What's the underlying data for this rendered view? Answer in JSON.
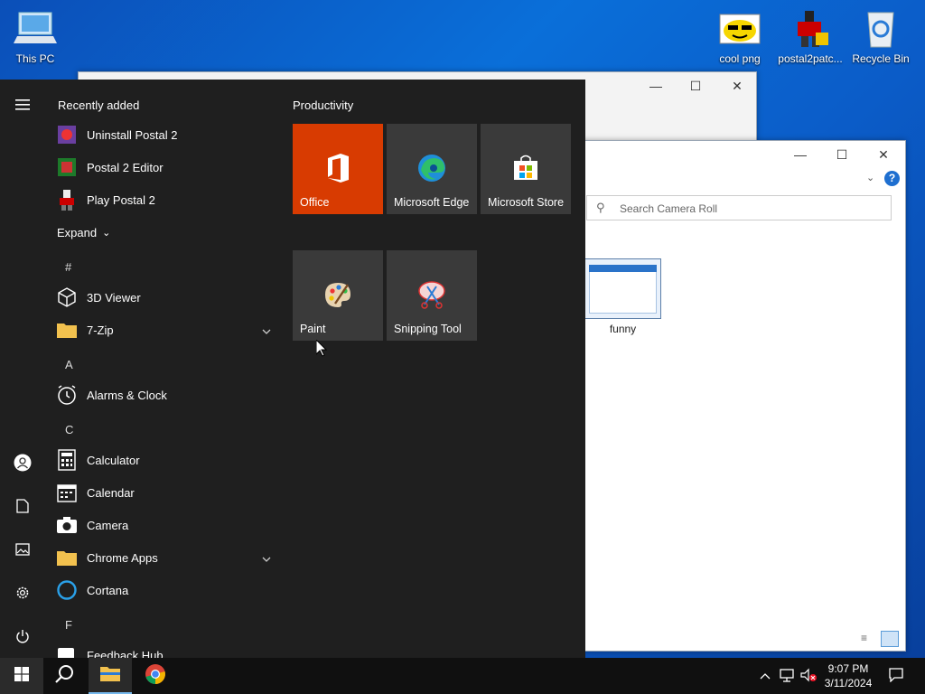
{
  "desktop": {
    "icons": [
      {
        "label": "This PC"
      },
      {
        "label": "cool png"
      },
      {
        "label": "postal2patc..."
      },
      {
        "label": "Recycle Bin"
      }
    ]
  },
  "explorer": {
    "search_placeholder": "Search Camera Roll",
    "file_label": "funny"
  },
  "start_menu": {
    "recently_added_label": "Recently added",
    "recent_items": [
      "Uninstall Postal 2",
      "Postal 2 Editor",
      "Play Postal 2"
    ],
    "expand_label": "Expand",
    "sections": {
      "hash": "#",
      "a": "A",
      "c": "C",
      "f": "F"
    },
    "apps": {
      "viewer3d": "3D Viewer",
      "zip": "7-Zip",
      "alarms": "Alarms & Clock",
      "calculator": "Calculator",
      "calendar": "Calendar",
      "camera": "Camera",
      "chrome_apps": "Chrome Apps",
      "cortana": "Cortana",
      "feedback": "Feedback Hub"
    },
    "group_title": "Productivity",
    "tiles": {
      "office": "Office",
      "edge": "Microsoft Edge",
      "store": "Microsoft Store",
      "paint": "Paint",
      "snipping": "Snipping Tool"
    },
    "tile_colors": {
      "office": "#d83b01",
      "default": "#3a3a3a"
    }
  },
  "taskbar": {
    "time": "9:07 PM",
    "date": "3/11/2024"
  }
}
